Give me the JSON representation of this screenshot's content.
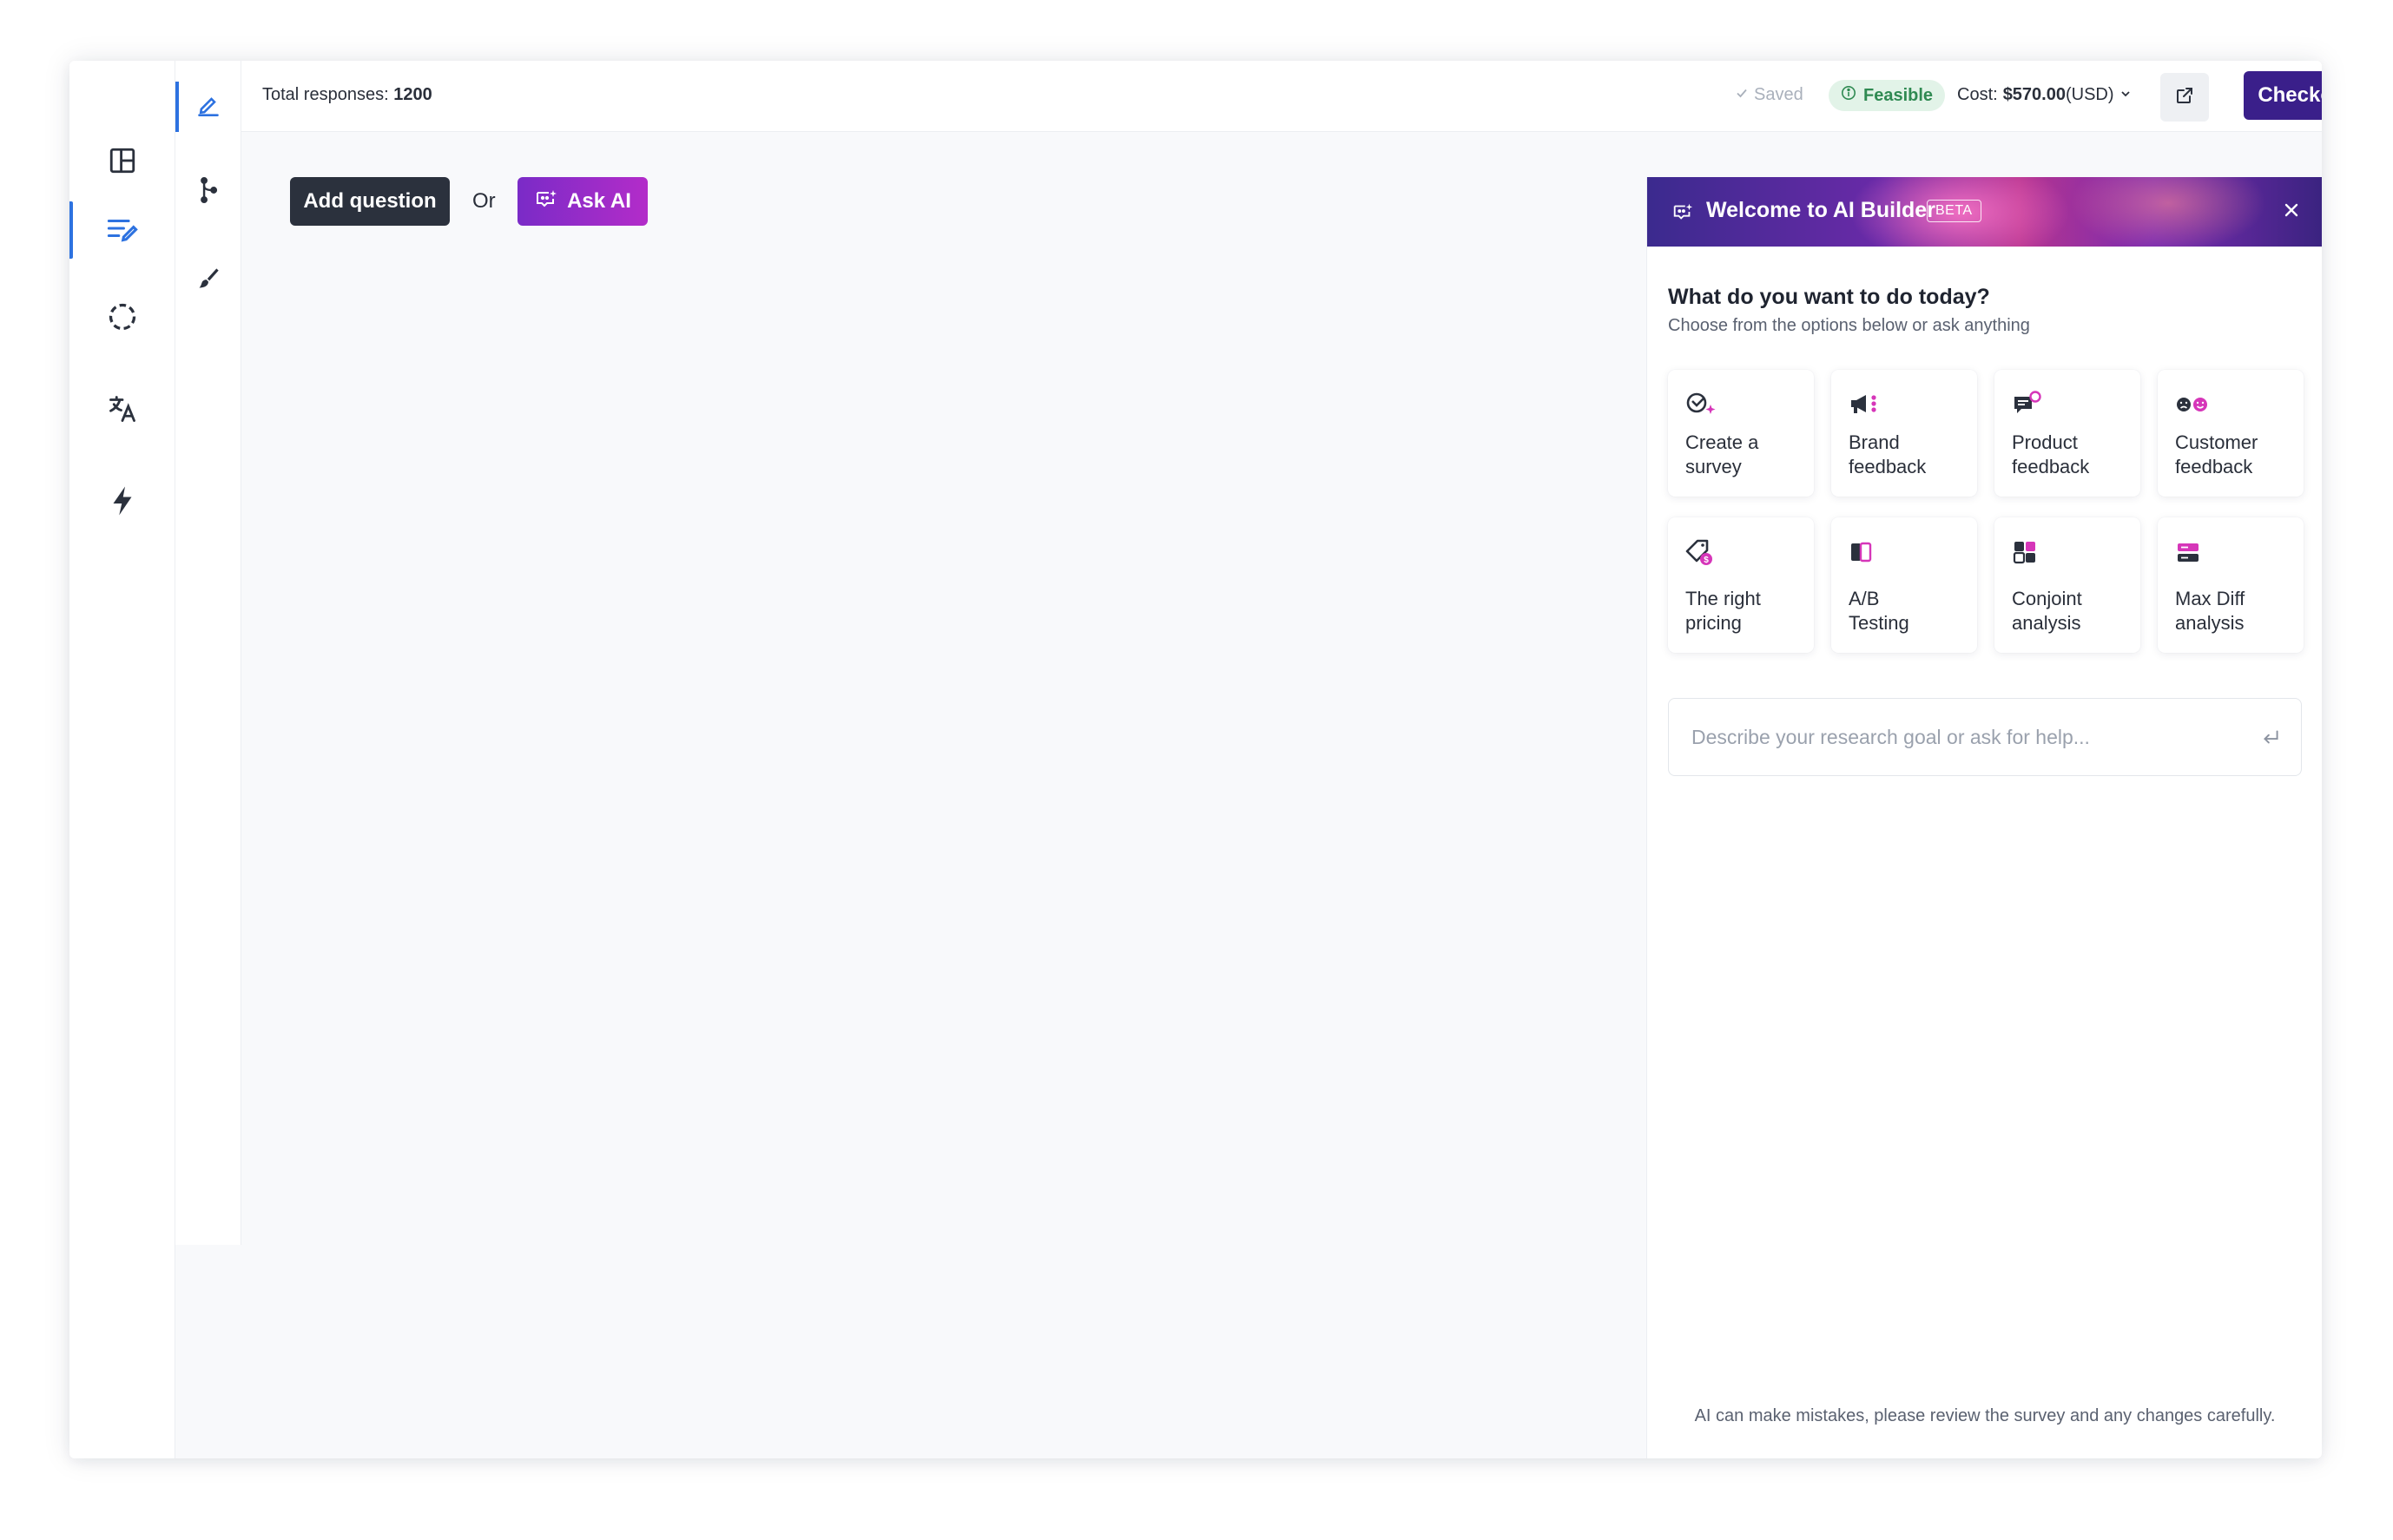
{
  "topbar": {
    "total_label": "Total responses:",
    "total_value": "1200",
    "saved": "Saved",
    "feasible": "Feasible",
    "cost_label": "Cost:",
    "cost_value": "$570.00",
    "cost_currency": "(USD)",
    "checkout": "Checkout"
  },
  "sidebar": {
    "items": [
      {
        "icon": "layout-icon"
      },
      {
        "icon": "edit-list-icon",
        "active": true
      },
      {
        "icon": "dashed-circle-icon"
      },
      {
        "icon": "translate-icon"
      },
      {
        "icon": "lightning-icon"
      }
    ]
  },
  "tools": {
    "items": [
      {
        "icon": "pen-icon",
        "active": true
      },
      {
        "icon": "branch-icon"
      },
      {
        "icon": "brush-icon"
      }
    ]
  },
  "canvas": {
    "add_question": "Add question",
    "or": "Or",
    "ask_ai": "Ask AI"
  },
  "ai_panel": {
    "title": "Welcome to AI Builder",
    "badge": "BETA",
    "heading": "What do you want to do today?",
    "subheading": "Choose from the options below or ask anything",
    "options": [
      {
        "label": "Create a\nsurvey",
        "icon": "survey-sparkle-icon"
      },
      {
        "label": "Brand\nfeedback",
        "icon": "megaphone-icon"
      },
      {
        "label": "Product\nfeedback",
        "icon": "chat-badge-icon"
      },
      {
        "label": "Customer\nfeedback",
        "icon": "faces-icon"
      },
      {
        "label": "The right\npricing",
        "icon": "price-tag-icon"
      },
      {
        "label": "A/B\nTesting",
        "icon": "ab-split-icon"
      },
      {
        "label": "Conjoint\nanalysis",
        "icon": "conjoint-icon"
      },
      {
        "label": "Max Diff\nanalysis",
        "icon": "maxdiff-icon"
      }
    ],
    "prompt_placeholder": "Describe your research goal or ask for help...",
    "disclaimer": "AI can make mistakes, please review the survey and any changes carefully."
  },
  "colors": {
    "accent_blue": "#2d72e0",
    "checkout_bg": "#3a1f8a",
    "ai_magenta": "#d636b9",
    "feasible_green": "#2f8a52"
  }
}
